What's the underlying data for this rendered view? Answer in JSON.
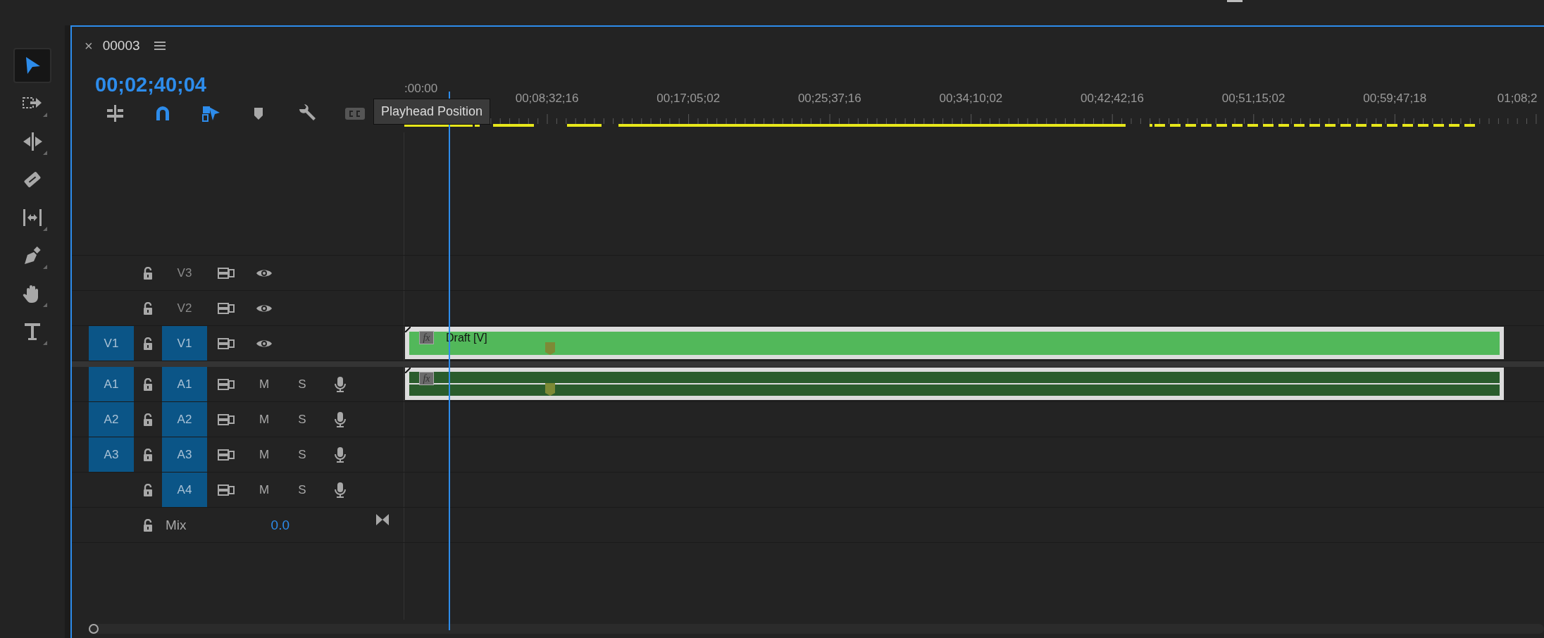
{
  "tools": [
    {
      "kind": "selection",
      "selected": true,
      "flyout": false
    },
    {
      "kind": "track-select",
      "selected": false,
      "flyout": true
    },
    {
      "kind": "ripple",
      "selected": false,
      "flyout": true
    },
    {
      "kind": "razor",
      "selected": false,
      "flyout": false
    },
    {
      "kind": "slip",
      "selected": false,
      "flyout": true
    },
    {
      "kind": "pen",
      "selected": false,
      "flyout": true
    },
    {
      "kind": "hand",
      "selected": false,
      "flyout": true
    },
    {
      "kind": "type",
      "selected": false,
      "flyout": true
    }
  ],
  "sequence_tab": {
    "close": "×",
    "name": "00003"
  },
  "timecode": "00;02;40;04",
  "toolbar": [
    {
      "kind": "nest",
      "on": false
    },
    {
      "kind": "snap",
      "on": true
    },
    {
      "kind": "linked",
      "on": true
    },
    {
      "kind": "marker",
      "on": false
    },
    {
      "kind": "settings",
      "on": false
    },
    {
      "kind": "captions",
      "on": false
    }
  ],
  "tooltip": "Playhead Position",
  "ruler": {
    "labels": [
      ":00:00",
      "00;08;32;16",
      "00;17;05;02",
      "00;25;37;16",
      "00;34;10;02",
      "00;42;42;16",
      "00;51;15;02",
      "00;59;47;18",
      "01;08;2"
    ]
  },
  "video_tracks": [
    {
      "name": "V3",
      "targeted": false
    },
    {
      "name": "V2",
      "targeted": false
    },
    {
      "name": "V1",
      "source": "V1",
      "targeted": true,
      "clips": [
        {
          "fx": "fx",
          "label": "Draft [V]"
        }
      ]
    }
  ],
  "audio_tracks": [
    {
      "name": "A1",
      "source": "A1",
      "targeted": true,
      "mute": "M",
      "solo": "S",
      "clips": [
        {
          "fx": "fx"
        }
      ]
    },
    {
      "name": "A2",
      "source": "A2",
      "targeted": true,
      "mute": "M",
      "solo": "S"
    },
    {
      "name": "A3",
      "source": "A3",
      "targeted": true,
      "mute": "M",
      "solo": "S"
    },
    {
      "name": "A4",
      "targeted": true,
      "mute": "M",
      "solo": "S"
    }
  ],
  "mix": {
    "label": "Mix",
    "value": "0.0"
  }
}
